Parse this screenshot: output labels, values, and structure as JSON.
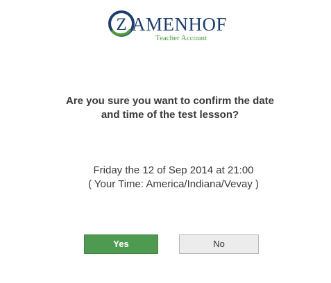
{
  "logo": {
    "emblem_letter": "Z",
    "name_rest": "AMENHOF",
    "subtitle": "Teacher Account"
  },
  "dialog": {
    "question_line1": "Are you sure you want to confirm the date",
    "question_line2": "and time of the test lesson?",
    "date_line": "Friday the 12 of Sep 2014 at 21:00",
    "timezone_line": "( Your Time: America/Indiana/Vevay )"
  },
  "buttons": {
    "yes_label": "Yes",
    "no_label": "No"
  },
  "colors": {
    "brand_blue": "#1d3e6e",
    "brand_green": "#4e9a3a",
    "yes_button": "#4e9a50",
    "no_button": "#ececec"
  }
}
